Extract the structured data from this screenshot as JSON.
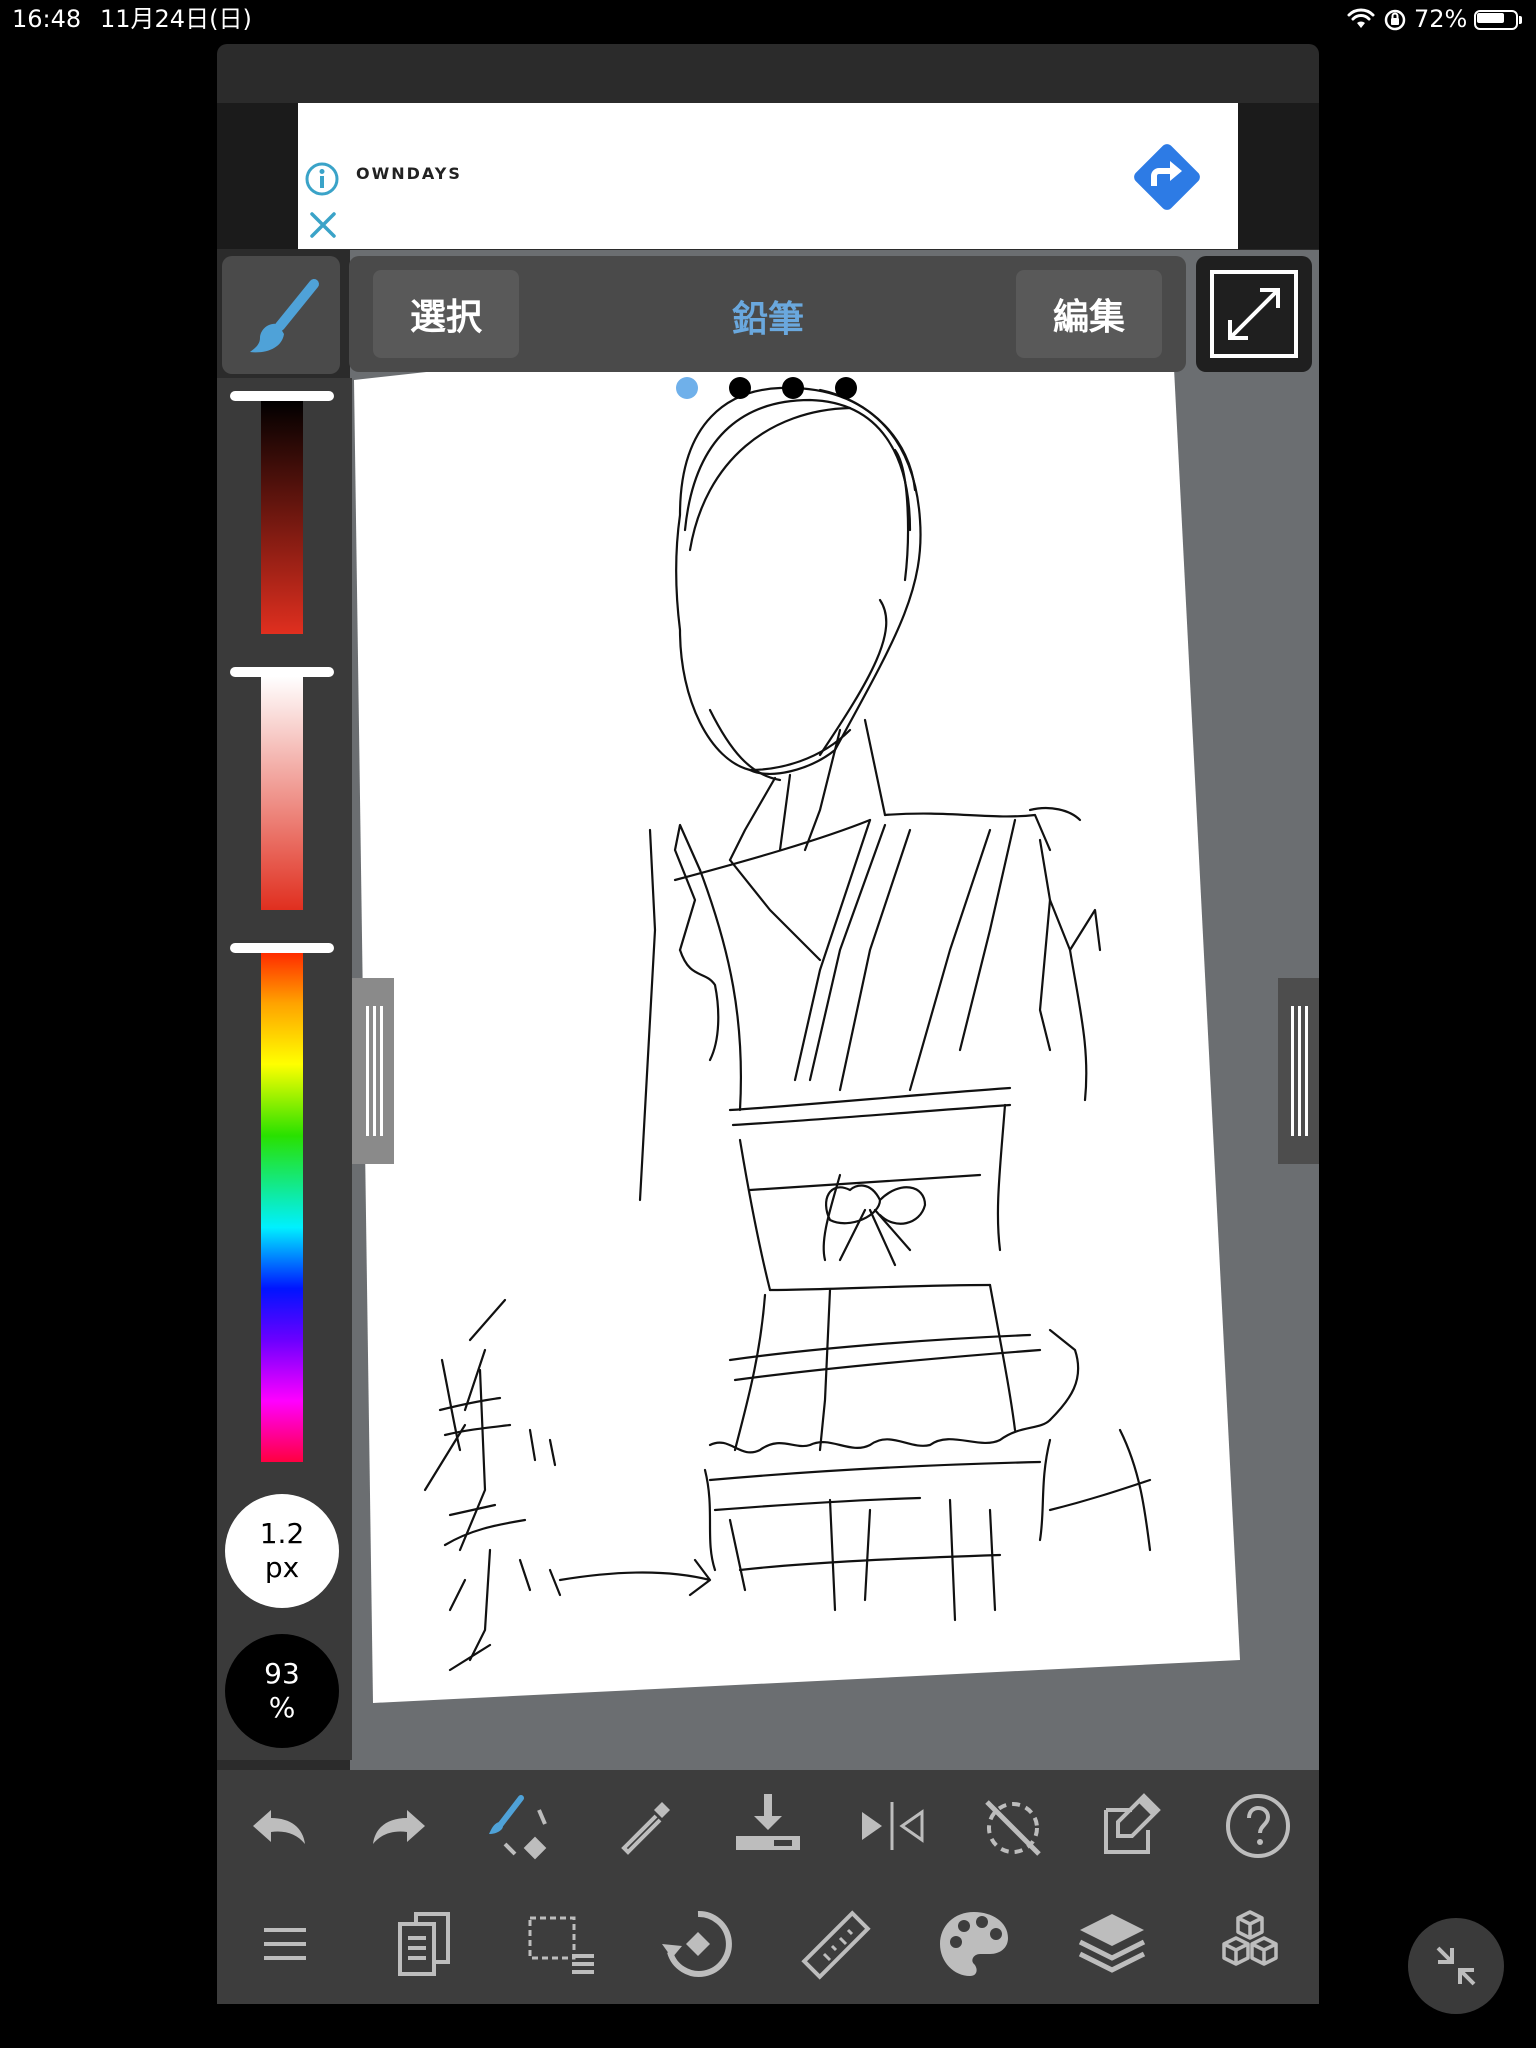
{
  "status_bar": {
    "time": "16:48",
    "date": "11月24日(日)",
    "battery_percent": "72%",
    "battery_level": 0.72
  },
  "ad": {
    "brand": "OWNDAYS",
    "icons": [
      "info-icon",
      "close-icon",
      "directions-icon"
    ]
  },
  "mode_bar": {
    "select_label": "選択",
    "tool_label": "鉛筆",
    "edit_label": "編集",
    "page_dots": 4,
    "active_dot": 0
  },
  "brush": {
    "size": "1.2",
    "size_unit": "px",
    "opacity": "93",
    "opacity_unit": "%"
  },
  "colors": {
    "accent": "#6aa8de",
    "app_bg": "#2b2b2b",
    "canvas_bg": "#6b6e71",
    "panel": "#4a4a4a"
  },
  "toolbar_top": {
    "items": [
      "undo-icon",
      "redo-icon",
      "brush-eraser-icon",
      "eyedropper-icon",
      "import-icon",
      "flip-icon",
      "rotate-reset-icon",
      "edit-layer-icon",
      "help-icon"
    ]
  },
  "toolbar_bottom": {
    "items": [
      "menu-icon",
      "pages-icon",
      "selection-icon",
      "transform-icon",
      "ruler-icon",
      "palette-icon",
      "layers-icon",
      "materials-icon"
    ]
  }
}
